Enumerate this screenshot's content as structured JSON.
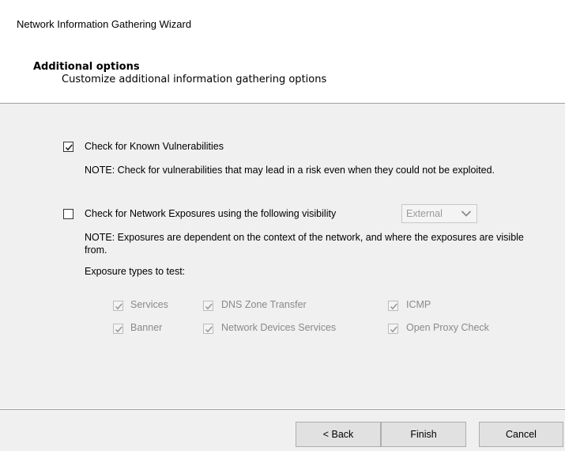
{
  "window": {
    "title": "Network Information Gathering Wizard"
  },
  "header": {
    "title": "Additional options",
    "subtitle": "Customize additional information gathering options"
  },
  "options": {
    "vulnerabilities": {
      "label": "Check for Known Vulnerabilities",
      "checked": true,
      "note": "NOTE: Check for vulnerabilities that may lead in a risk even when they could not be exploited."
    },
    "exposures": {
      "label": "Check for Network Exposures using the following visibility",
      "checked": false,
      "visibility": "External",
      "note": "NOTE: Exposures are dependent on the context of the network, and where the exposures are visible from.",
      "types_heading": "Exposure types to test:",
      "types": [
        {
          "label": "Services",
          "checked": true,
          "enabled": false
        },
        {
          "label": "DNS Zone Transfer",
          "checked": true,
          "enabled": false
        },
        {
          "label": "ICMP",
          "checked": true,
          "enabled": false
        },
        {
          "label": "Banner",
          "checked": true,
          "enabled": false
        },
        {
          "label": "Network Devices Services",
          "checked": true,
          "enabled": false
        },
        {
          "label": "Open Proxy Check",
          "checked": true,
          "enabled": false
        }
      ]
    }
  },
  "buttons": {
    "back": "< Back",
    "finish": "Finish",
    "cancel": "Cancel"
  },
  "icons": {
    "check": "checkmark-icon",
    "dropdown": "chevron-down-icon"
  }
}
